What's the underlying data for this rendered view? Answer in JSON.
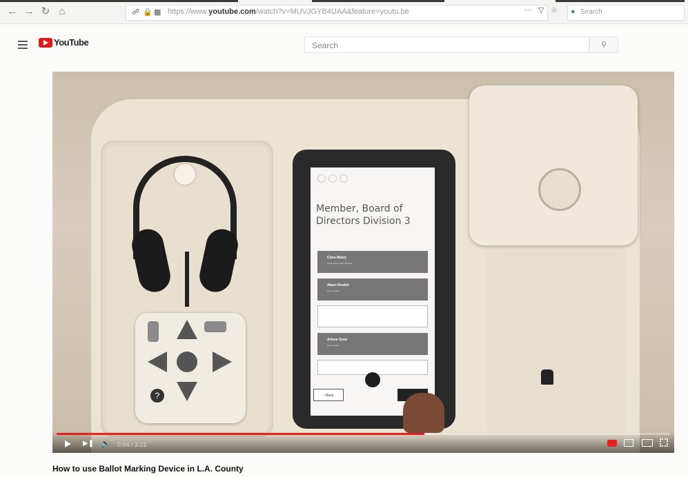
{
  "browser": {
    "url_prefix": "https://www.",
    "url_domain": "youtube.com",
    "url_rest": "/watch?v=MUVJGYB4UAA&feature=youtu.be",
    "search_placeholder": "Search",
    "more_label": "···"
  },
  "youtube": {
    "logo_text": "YouTube",
    "search_placeholder": "Search"
  },
  "video": {
    "screen_title": "Member, Board of Directors Division 3",
    "candidates": [
      {
        "name": "Clara Maloy",
        "sub": "Lorem ipsum dolor sit amet"
      },
      {
        "name": "Alann Ruskin",
        "sub": "Lorem ipsum"
      },
      {
        "name": "",
        "sub": ""
      },
      {
        "name": "Arlene Gose",
        "sub": "Lorem ipsum"
      },
      {
        "name": "",
        "sub": ""
      }
    ],
    "back_label": "‹ Back",
    "time": "0:04 / 3:21",
    "progress": 0.6
  },
  "page": {
    "title": "How to use Ballot Marking Device in L.A. County"
  }
}
